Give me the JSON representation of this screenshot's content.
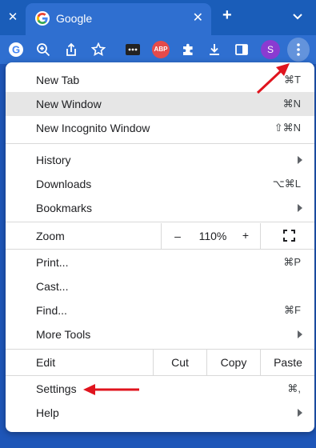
{
  "tab": {
    "title": "Google"
  },
  "toolbar": {
    "avatar_letter": "S",
    "abp_label": "ABP"
  },
  "menu": {
    "new_tab": {
      "label": "New Tab",
      "shortcut": "⌘T"
    },
    "new_window": {
      "label": "New Window",
      "shortcut": "⌘N"
    },
    "new_incognito": {
      "label": "New Incognito Window",
      "shortcut": "⇧⌘N"
    },
    "history": {
      "label": "History"
    },
    "downloads": {
      "label": "Downloads",
      "shortcut": "⌥⌘L"
    },
    "bookmarks": {
      "label": "Bookmarks"
    },
    "zoom": {
      "label": "Zoom",
      "minus": "–",
      "level": "110%",
      "plus": "+"
    },
    "print": {
      "label": "Print...",
      "shortcut": "⌘P"
    },
    "cast": {
      "label": "Cast..."
    },
    "find": {
      "label": "Find...",
      "shortcut": "⌘F"
    },
    "more_tools": {
      "label": "More Tools"
    },
    "edit": {
      "label": "Edit",
      "cut": "Cut",
      "copy": "Copy",
      "paste": "Paste"
    },
    "settings": {
      "label": "Settings",
      "shortcut": "⌘,"
    },
    "help": {
      "label": "Help"
    }
  },
  "colors": {
    "chrome_blue": "#2f6fd0",
    "highlight": "#e6e6e6",
    "annotation_red": "#e0141e"
  }
}
